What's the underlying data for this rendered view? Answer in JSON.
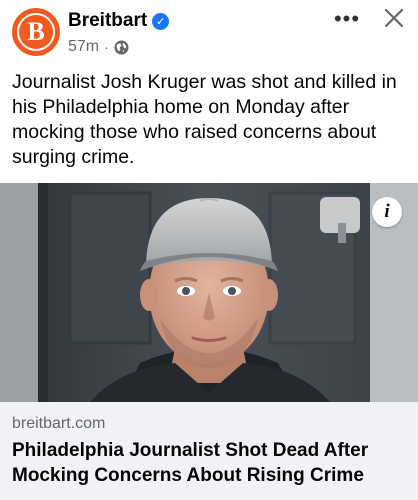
{
  "page": {
    "name": "Breitbart",
    "avatar_letter": "B",
    "timestamp": "57m",
    "separator": "·",
    "privacy_icon": "globe-icon",
    "verified_icon": "verified-badge-icon"
  },
  "actions": {
    "more_label": "•••",
    "close_icon": "close-icon"
  },
  "post": {
    "text": "Journalist Josh Kruger was shot and killed in his Philadelphia home on Monday after mocking those who raised concerns about surging crime."
  },
  "media": {
    "info_label": "i",
    "info_icon": "info-icon"
  },
  "link_preview": {
    "domain": "breitbart.com",
    "title": "Philadelphia Journalist Shot Dead After Mocking Concerns About Rising Crime"
  },
  "colors": {
    "brand": "#f05a1e",
    "verified": "#1877f2",
    "secondary_text": "#65676b",
    "link_bg": "#f0f2f5"
  }
}
